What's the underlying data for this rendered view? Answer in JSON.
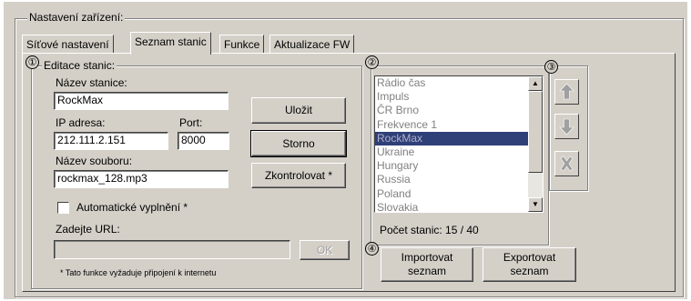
{
  "main_group": {
    "legend": "Nastavení zařízení:"
  },
  "tabs": [
    {
      "label": "Síťové nastavení"
    },
    {
      "label": "Seznam stanic"
    },
    {
      "label": "Funkce"
    },
    {
      "label": "Aktualizace FW"
    }
  ],
  "markers": [
    "①",
    "②",
    "③",
    "④"
  ],
  "editor": {
    "legend": "Editace stanic:",
    "station_name_label": "Název stanice:",
    "station_name_value": "RockMax",
    "ip_label": "IP adresa:",
    "ip_value": "212.111.2.151",
    "port_label": "Port:",
    "port_value": "8000",
    "filename_label": "Název souboru:",
    "filename_value": "rockmax_128.mp3",
    "auto_fill_label": "Automatické vyplnění *",
    "url_label": "Zadejte URL:",
    "url_value": "",
    "ok_label": "OK",
    "footnote": "* Tato funkce vyžaduje připojení k internetu",
    "save_label": "Uložit",
    "cancel_label": "Storno",
    "check_label": "Zkontrolovat *"
  },
  "stations": {
    "items": [
      "Rádio čas",
      "Impuls",
      "ČR Brno",
      "Frekvence 1",
      "RockMax",
      "Ukraine",
      "Hungary",
      "Russia",
      "Poland",
      "Slovakia"
    ],
    "selected_index": 4,
    "count_text": "Počet stanic: 15 / 40"
  },
  "order_buttons": {
    "up_icon": "arrow-up-icon",
    "down_icon": "arrow-down-icon",
    "delete_icon": "delete-x-icon"
  },
  "import_export": {
    "import_label_1": "Importovat",
    "import_label_2": "seznam",
    "export_label_1": "Exportovat",
    "export_label_2": "seznam"
  },
  "colors": {
    "dialog_bg": "#d4d0c8",
    "selection": "#2f3f78"
  }
}
